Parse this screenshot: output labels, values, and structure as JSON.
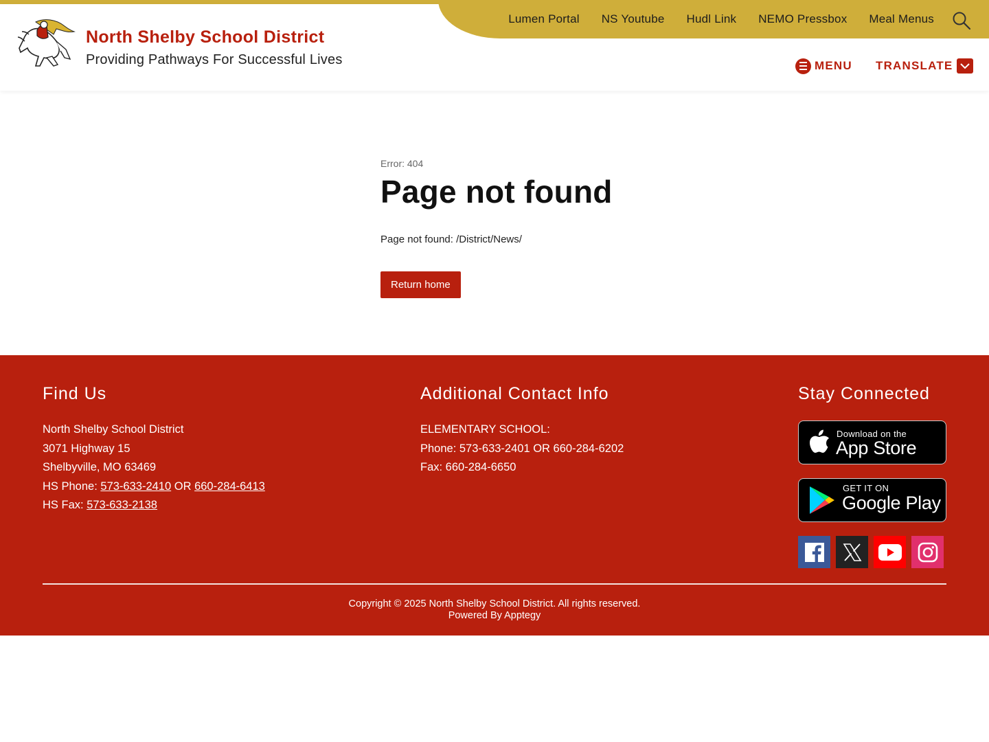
{
  "utility_nav": {
    "links": [
      "Lumen Portal",
      "NS Youtube",
      "Hudl Link",
      "NEMO Pressbox",
      "Meal Menus"
    ]
  },
  "header": {
    "title": "North Shelby School District",
    "tagline": "Providing Pathways For Successful Lives",
    "menu_label": "MENU",
    "translate_label": "TRANSLATE"
  },
  "main": {
    "error_code": "Error: 404",
    "title": "Page not found",
    "message": "Page not found: /District/News/",
    "return_label": "Return home"
  },
  "footer": {
    "find_us": {
      "heading": "Find Us",
      "name": "North Shelby School District",
      "address1": "3071 Highway 15",
      "address2": "Shelbyville, MO 63469",
      "hs_phone_label": "HS Phone: ",
      "hs_phone_1": "573-633-2410",
      "hs_phone_or": " OR ",
      "hs_phone_2": "660-284-6413",
      "hs_fax_label": "HS Fax: ",
      "hs_fax": "573-633-2138"
    },
    "contact": {
      "heading": "Additional Contact Info",
      "line1": "ELEMENTARY SCHOOL:",
      "line2": "Phone: 573-633-2401 OR 660-284-6202",
      "line3": "Fax: 660-284-6650"
    },
    "stay": {
      "heading": "Stay Connected",
      "app_store_small": "Download on the",
      "app_store_big": "App Store",
      "google_small": "GET IT ON",
      "google_big": "Google Play"
    },
    "copyright": "Copyright © 2025 North Shelby School District. All rights reserved.",
    "powered_by": "Powered By Apptegy"
  },
  "colors": {
    "brand_red": "#b8200e",
    "brand_gold": "#cfae3a",
    "facebook": "#3b5998",
    "x": "#000000",
    "youtube": "#ff0000",
    "instagram": "#e1306c"
  }
}
